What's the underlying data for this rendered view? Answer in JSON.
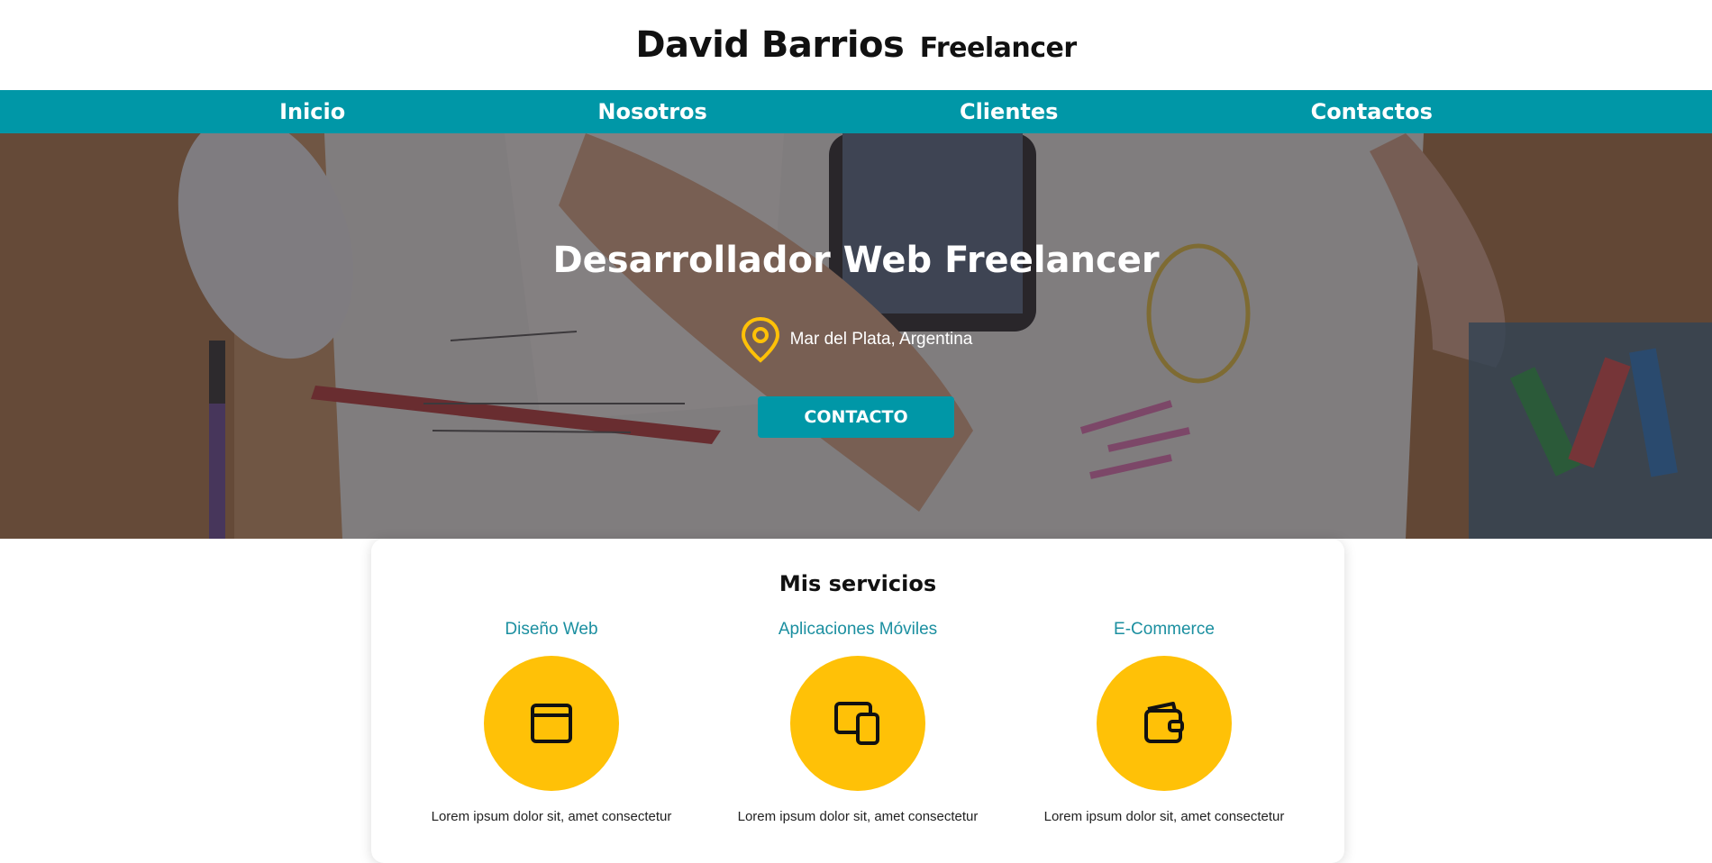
{
  "header": {
    "name": "David Barrios",
    "role": "Freelancer"
  },
  "nav": {
    "items": [
      {
        "label": "Inicio"
      },
      {
        "label": "Nosotros"
      },
      {
        "label": "Clientes"
      },
      {
        "label": "Contactos"
      }
    ]
  },
  "hero": {
    "title": "Desarrollador Web Freelancer",
    "location": "Mar del Plata, Argentina",
    "location_icon": "map-pin-icon",
    "cta_label": "CONTACTO",
    "background": "desk-with-hands-sketching-photo"
  },
  "services": {
    "title": "Mis servicios",
    "items": [
      {
        "name": "Diseño Web",
        "icon": "browser-window-icon",
        "text": "Lorem ipsum dolor sit, amet consectetur"
      },
      {
        "name": "Aplicaciones Móviles",
        "icon": "devices-icon",
        "text": "Lorem ipsum dolor sit, amet consectetur"
      },
      {
        "name": "E-Commerce",
        "icon": "wallet-icon",
        "text": "Lorem ipsum dolor sit, amet consectetur"
      }
    ]
  },
  "colors": {
    "primary": "#0097a7",
    "accent": "#ffc107",
    "service_name": "#1b8fa0"
  }
}
